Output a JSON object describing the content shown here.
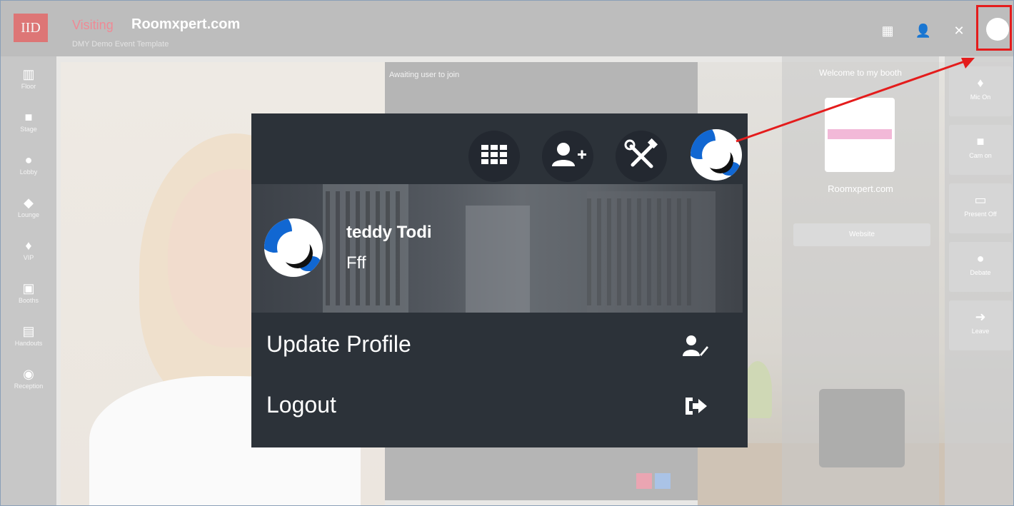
{
  "app": {
    "logo_text": "IID",
    "brand_prefix": "Visiting",
    "brand": "Roomxpert.com",
    "subtitle": "DMY Demo Event Template"
  },
  "top_icons": [
    "grid-icon",
    "add-user-icon",
    "tools-icon",
    "profile-avatar"
  ],
  "sidebar": {
    "items": [
      {
        "label": "Floor",
        "icon": "map-icon"
      },
      {
        "label": "Stage",
        "icon": "video-camera-icon"
      },
      {
        "label": "Lobby",
        "icon": "people-icon"
      },
      {
        "label": "Lounge",
        "icon": "handshake-icon"
      },
      {
        "label": "VIP",
        "icon": "microphone-icon"
      },
      {
        "label": "Booths",
        "icon": "storefront-icon"
      },
      {
        "label": "Handouts",
        "icon": "document-icon"
      },
      {
        "label": "Reception",
        "icon": "reception-icon"
      }
    ]
  },
  "video": {
    "status": "Awaiting user to join"
  },
  "booth": {
    "welcome": "Welcome to my booth",
    "name": "Roomxpert.com",
    "website_button": "Website"
  },
  "right_controls": [
    {
      "label": "Mic On",
      "icon": "microphone-icon"
    },
    {
      "label": "Cam on",
      "icon": "camera-icon"
    },
    {
      "label": "Present Off",
      "icon": "monitor-icon"
    },
    {
      "label": "Debate",
      "icon": "chat-icon"
    },
    {
      "label": "Leave",
      "icon": "exit-icon"
    }
  ],
  "profile_menu": {
    "user_name": "teddy Todi",
    "user_subtitle": "Fff",
    "update_profile_label": "Update Profile",
    "logout_label": "Logout"
  },
  "colors": {
    "popup_bg": "#2c3239",
    "highlight_red": "#e41c1c",
    "avatar_blue": "#1167d2"
  }
}
